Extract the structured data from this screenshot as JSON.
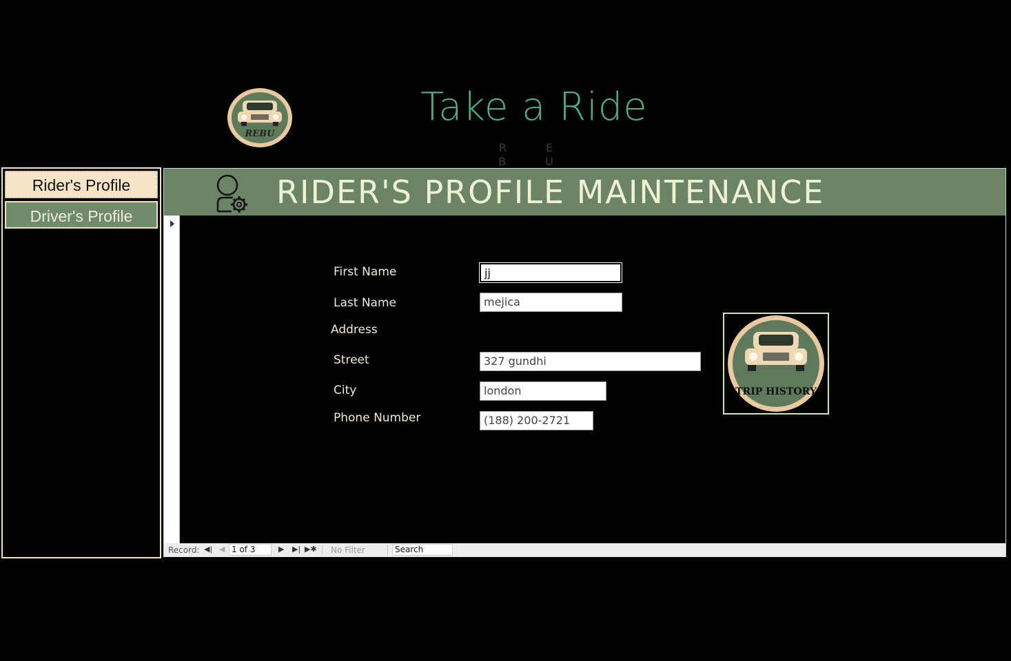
{
  "app": {
    "title": "Take a Ride",
    "subtitle": "R E B U",
    "logo_text": "REBU"
  },
  "nav": {
    "items": [
      {
        "label": "Rider's Profile"
      },
      {
        "label": "Driver's Profile"
      }
    ]
  },
  "form": {
    "title": "RIDER'S PROFILE MAINTENANCE",
    "fields": {
      "first_name": {
        "label": "First Name",
        "value": "jj"
      },
      "last_name": {
        "label": "Last Name",
        "value": "mejica"
      },
      "address": {
        "label": "Address"
      },
      "street": {
        "label": "Street",
        "value": "327 gundhi"
      },
      "city": {
        "label": "City",
        "value": "london"
      },
      "phone": {
        "label": "Phone Number",
        "value": "(188) 200-2721"
      }
    },
    "trip_history_button": {
      "label": "TRIP HISTORY"
    }
  },
  "navbar": {
    "record_label": "Record:",
    "record_value": "1 of 3",
    "filter_label": "No Filter",
    "search_label": "Search"
  },
  "colors": {
    "accent_green": "#6b8465",
    "title_green": "#4fae82",
    "cream": "#f7e4c8"
  }
}
